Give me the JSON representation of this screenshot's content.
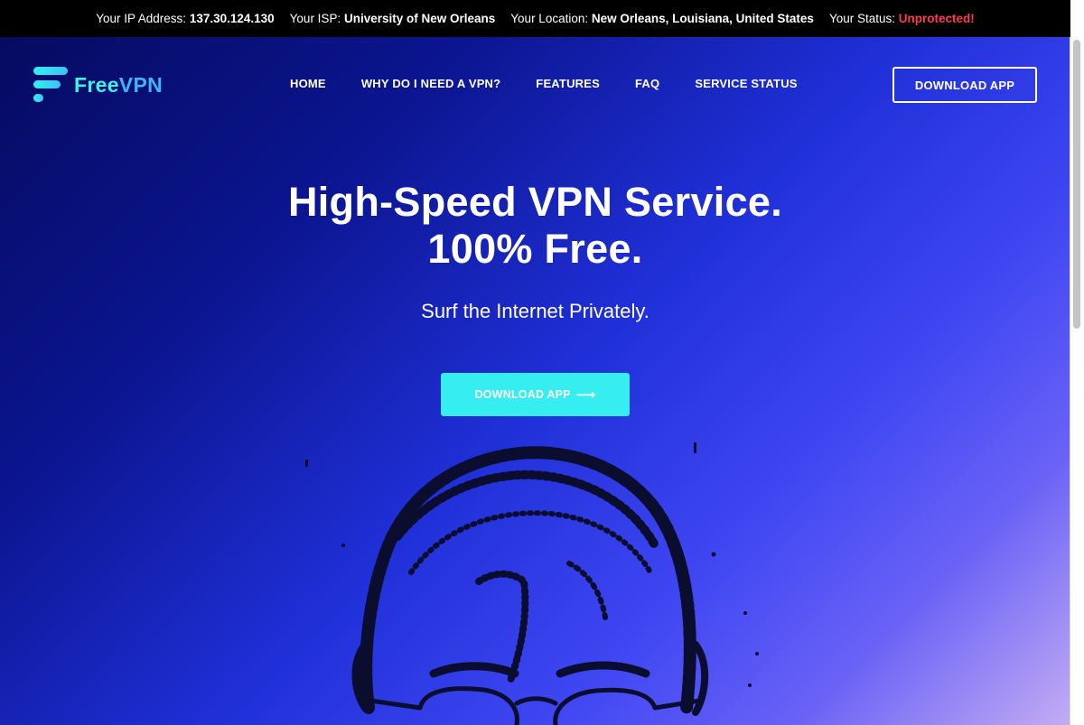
{
  "infobar": {
    "ip_label": "Your IP Address:",
    "ip_value": "137.30.124.130",
    "isp_label": "Your ISP:",
    "isp_value": "University of New Orleans",
    "location_label": "Your Location:",
    "location_value": "New Orleans, Louisiana, United States",
    "status_label": "Your Status:",
    "status_value": "Unprotected!",
    "status_color": "#ff3b4e"
  },
  "logo": {
    "part1": "Free",
    "part2": "VPN",
    "colors": [
      "#3ff2e8",
      "#3fb4f7"
    ]
  },
  "nav": {
    "items": [
      "HOME",
      "WHY DO I NEED A VPN?",
      "FEATURES",
      "FAQ",
      "SERVICE STATUS"
    ]
  },
  "header": {
    "download_label": "DOWNLOAD APP"
  },
  "hero": {
    "title_line1": "High-Speed VPN Service.",
    "title_line2": "100% Free.",
    "subtitle": "Surf the Internet Privately.",
    "cta_label": "DOWNLOAD APP",
    "cta_icon": "arrow-right-icon",
    "cta_color": "#36eef0"
  },
  "colors": {
    "background_start": "#050a5c",
    "background_end": "#c8b0f4"
  }
}
